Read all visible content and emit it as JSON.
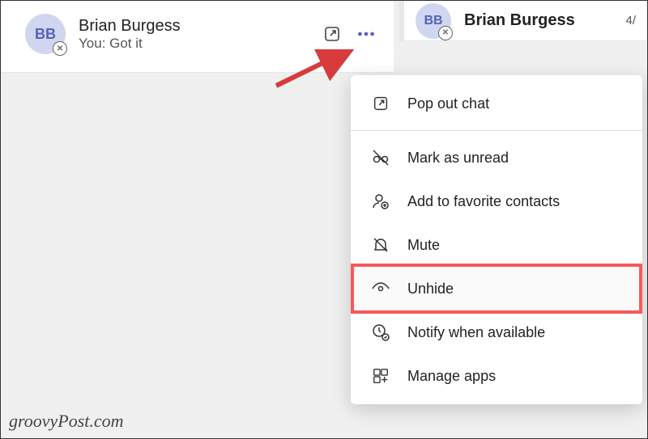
{
  "chat_item": {
    "avatar_initials": "BB",
    "name": "Brian Burgess",
    "preview": "You: Got it",
    "presence_glyph": "✕"
  },
  "right_panel": {
    "avatar_initials": "BB",
    "name": "Brian Burgess",
    "meta": "4/"
  },
  "menu": {
    "popout": "Pop out chat",
    "unread": "Mark as unread",
    "favorite": "Add to favorite contacts",
    "mute": "Mute",
    "unhide": "Unhide",
    "notify": "Notify when available",
    "apps": "Manage apps"
  },
  "watermark": "groovyPost.com"
}
